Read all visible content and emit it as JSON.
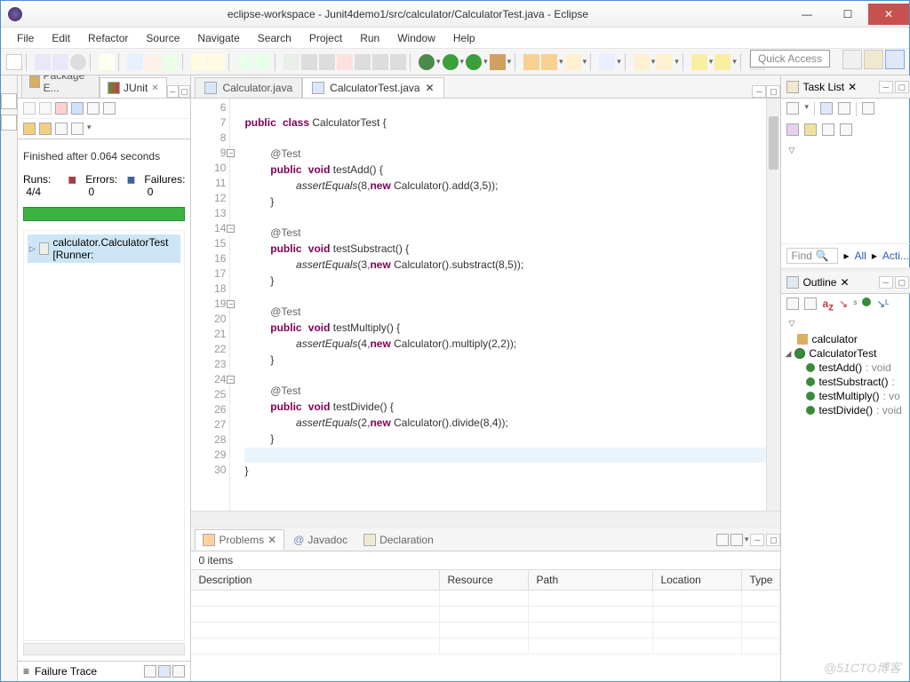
{
  "window": {
    "title": "eclipse-workspace - Junit4demo1/src/calculator/CalculatorTest.java - Eclipse"
  },
  "menu": [
    "File",
    "Edit",
    "Refactor",
    "Source",
    "Navigate",
    "Search",
    "Project",
    "Run",
    "Window",
    "Help"
  ],
  "quick_access": "Quick Access",
  "left_tabs": {
    "package": "Package E...",
    "junit": "JUnit"
  },
  "junit": {
    "finished": "Finished after 0.064 seconds",
    "runs_label": "Runs:",
    "runs_value": "4/4",
    "errors_label": "Errors:",
    "errors_value": "0",
    "failures_label": "Failures:",
    "failures_value": "0",
    "tree_item": "calculator.CalculatorTest [Runner:",
    "failure_trace": "Failure Trace"
  },
  "editor": {
    "tab1": "Calculator.java",
    "tab2": "CalculatorTest.java",
    "lines": [
      "6",
      "7",
      "8",
      "9",
      "10",
      "11",
      "12",
      "13",
      "14",
      "15",
      "16",
      "17",
      "18",
      "19",
      "20",
      "21",
      "22",
      "23",
      "24",
      "25",
      "26",
      "27",
      "28",
      "29",
      "30"
    ],
    "code": {
      "l7a": "public",
      "l7b": "class",
      "l7c": " CalculatorTest {",
      "ann": "@Test",
      "pub": "public",
      "void": "void",
      "m1": " testAdd() {",
      "a1a": "assertEquals",
      "a1b": "(8,",
      "new": "new",
      "a1c": " Calculator().add(3,5));",
      "cb": "}",
      "m2": " testSubstract() {",
      "a2c": " Calculator().substract(8,5));",
      "a2b": "(3,",
      "m3": " testMultiply() {",
      "a3c": " Calculator().multiply(2,2));",
      "a3b": "(4,",
      "m4": " testDivide() {",
      "a4c": " Calculator().divide(8,4));",
      "a4b": "(2,"
    }
  },
  "problems": {
    "tab1": "Problems",
    "tab2": "Javadoc",
    "tab3": "Declaration",
    "count": "0 items",
    "cols": {
      "desc": "Description",
      "res": "Resource",
      "path": "Path",
      "loc": "Location",
      "type": "Type"
    }
  },
  "tasklist": {
    "title": "Task List",
    "find": "Find",
    "all": "All",
    "activate": "Acti..."
  },
  "outline": {
    "title": "Outline",
    "pkg": "calculator",
    "cls": "CalculatorTest",
    "m1": "testAdd()",
    "m1r": " : void",
    "m2": "testSubstract()",
    "m2r": " : ",
    "m3": "testMultiply()",
    "m3r": " : vo",
    "m4": "testDivide()",
    "m4r": " : void"
  },
  "watermark": "@51CTO博客"
}
